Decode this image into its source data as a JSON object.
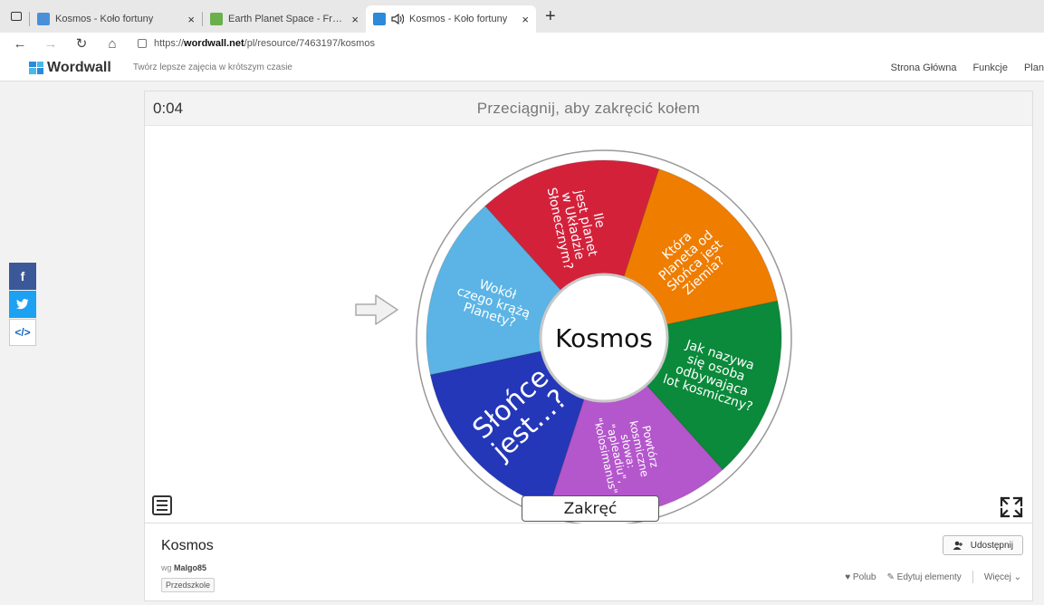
{
  "browser": {
    "tabs": [
      {
        "title": "Kosmos - Koło fortuny",
        "active": false,
        "favicon_color": "#4a90d9"
      },
      {
        "title": "Earth Planet Space - Free photo",
        "active": false,
        "favicon_color": "#6ab04c"
      },
      {
        "title": "Kosmos - Koło fortuny",
        "active": true,
        "favicon_color": "#2b8ad9"
      }
    ],
    "close_glyph": "×",
    "new_tab_glyph": "+",
    "url_prefix": "https://",
    "url_domain": "wordwall.net",
    "url_path": "/pl/resource/7463197/kosmos"
  },
  "site": {
    "logo_text": "Wordwall",
    "tagline": "Twórz lepsze zajęcia w krótszym czasie",
    "nav": [
      "Strona Główna",
      "Funkcje",
      "Plan"
    ]
  },
  "social": {
    "facebook": "f",
    "twitter": "t",
    "embed": "</>"
  },
  "activity": {
    "timer": "0:04",
    "instruction": "Przeciągnij, aby zakręcić kołem",
    "wheel": {
      "center_label": "Kosmos",
      "segments": [
        {
          "lines": [
            "Która",
            "Planeta od",
            "Słońca jest",
            "Ziemia?"
          ],
          "color": "#ef7d00"
        },
        {
          "lines": [
            "Jak nazywa",
            "się osoba",
            "odbywająca",
            "lot kosmiczny?"
          ],
          "color": "#0a8a3a"
        },
        {
          "lines": [
            "Powtórz",
            "kosmiczne",
            "słowa:",
            "\"apleadiu\",",
            "\"kolosimanus\""
          ],
          "color": "#b456cc"
        },
        {
          "lines": [
            "Słońce",
            "jest...?"
          ],
          "color": "#2437b8"
        },
        {
          "lines": [
            "Wokół",
            "czego krążą",
            "Planety?"
          ],
          "color": "#5bb4e5"
        },
        {
          "lines": [
            "Ile",
            "jest planet",
            "w Układzie",
            "Słonecznym?"
          ],
          "color": "#d4213a"
        }
      ]
    },
    "spin_label": "Zakręć"
  },
  "info": {
    "title": "Kosmos",
    "author_prefix": "wg",
    "author": "Malgo85",
    "tag": "Przedszkole",
    "share_label": "Udostępnij",
    "like_label": "Polub",
    "edit_label": "Edytuj elementy",
    "more_label": "Więcej"
  }
}
